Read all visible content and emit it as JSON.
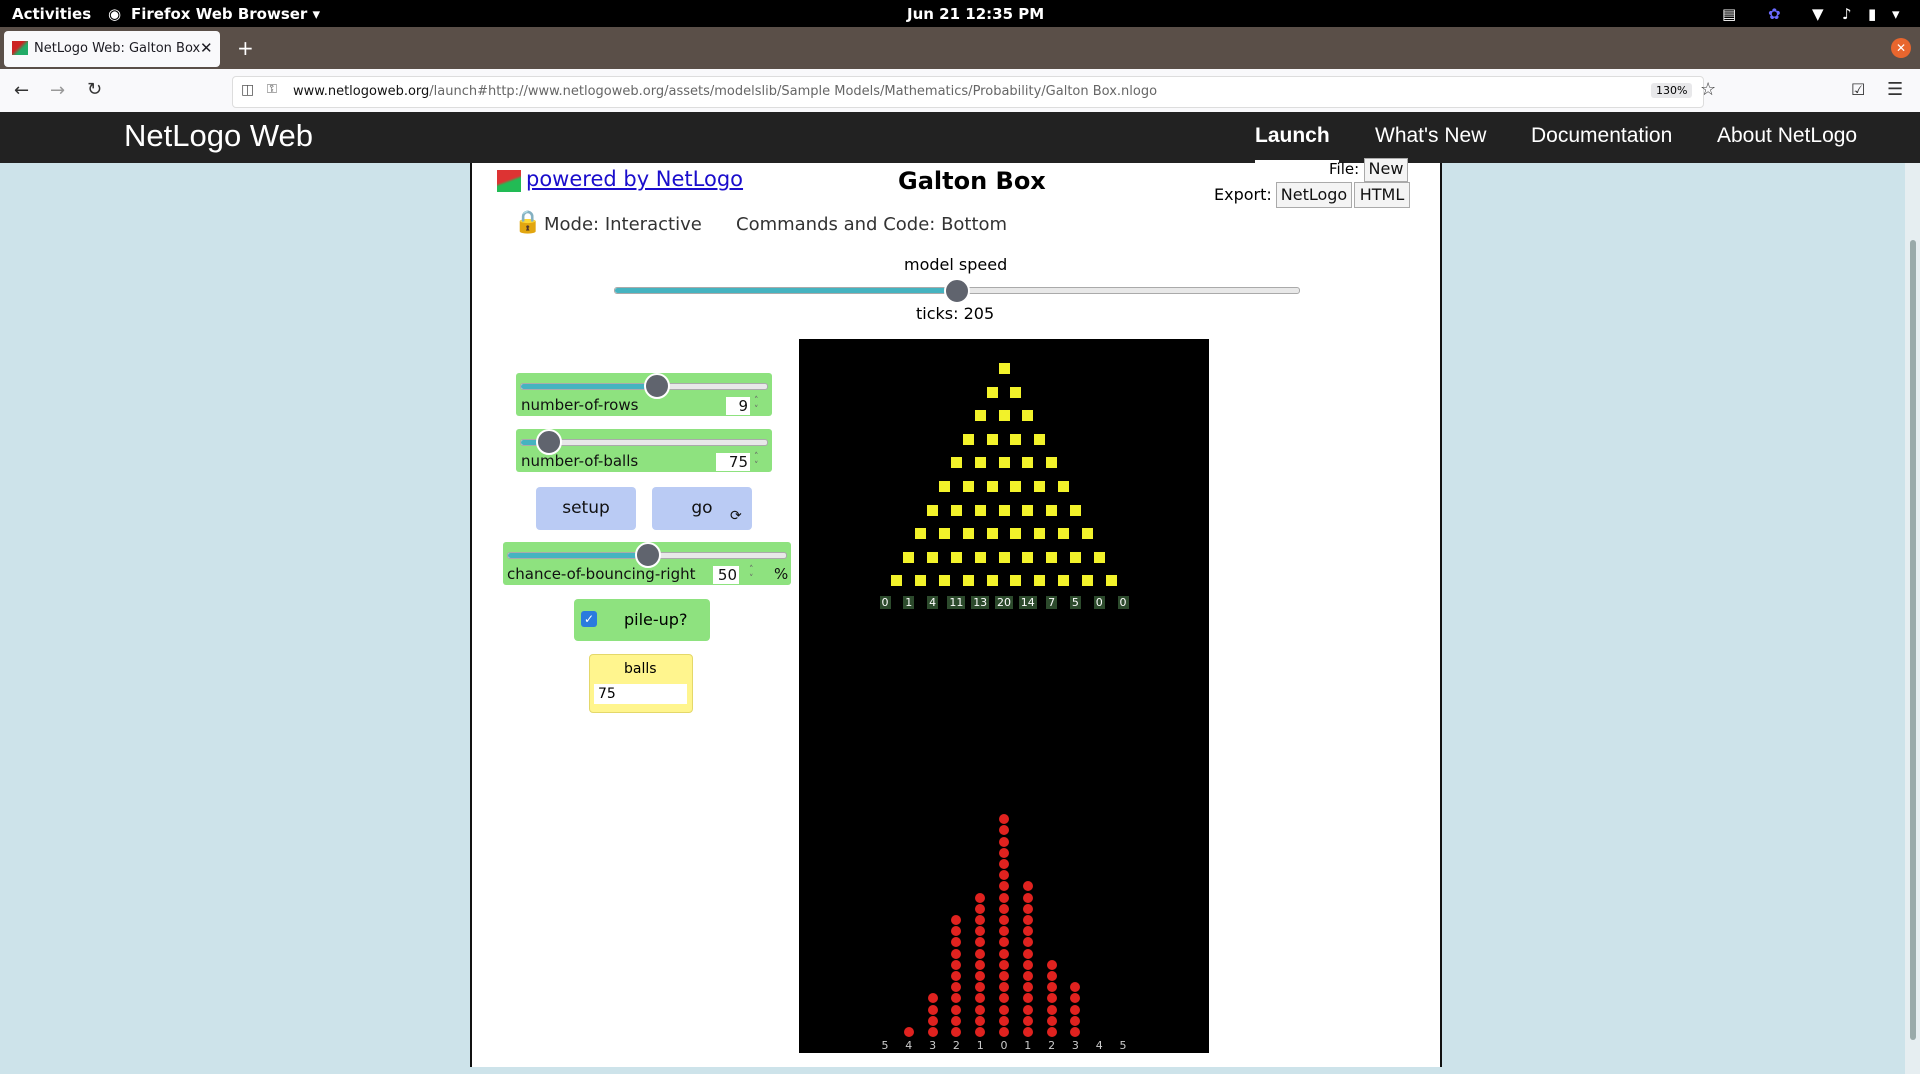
{
  "os": {
    "activities": "Activities",
    "app_menu": "Firefox Web Browser",
    "clock": "Jun 21  12:35 PM"
  },
  "browser": {
    "tab_title": "NetLogo Web: Galton Box",
    "url_domain": "www.netlogoweb.org",
    "url_rest": "/launch#http://www.netlogoweb.org/assets/modelslib/Sample Models/Mathematics/Probability/Galton Box.nlogo",
    "zoom": "130%"
  },
  "site": {
    "title": "NetLogo Web",
    "nav": [
      "Launch",
      "What's New",
      "Documentation",
      "About NetLogo"
    ]
  },
  "model": {
    "powered_by": "powered by NetLogo",
    "title": "Galton Box",
    "mode": "Mode: Interactive",
    "commands": "Commands and Code: Bottom",
    "file_label": "File:",
    "file_new": "New",
    "export_label": "Export:",
    "export_netlogo": "NetLogo",
    "export_html": "HTML",
    "speed_label": "model speed",
    "speed_value": 0.5,
    "ticks": "ticks: 205"
  },
  "widgets": {
    "rows": {
      "label": "number-of-rows",
      "value": "9",
      "fraction": 0.55
    },
    "balls_slider": {
      "label": "number-of-balls",
      "value": "75",
      "fraction": 0.1
    },
    "setup": "setup",
    "go": "go",
    "chance": {
      "label": "chance-of-bouncing-right",
      "value": "50",
      "unit": "%",
      "fraction": 0.5
    },
    "pileup": {
      "label": "pile-up?",
      "checked": true
    },
    "monitor": {
      "label": "balls",
      "value": "75"
    }
  },
  "world": {
    "bin_counts": [
      "0",
      "1",
      "4",
      "11",
      "13",
      "20",
      "14",
      "7",
      "5",
      "0",
      "0"
    ],
    "column_balls": [
      0,
      1,
      4,
      11,
      13,
      20,
      14,
      7,
      5,
      0,
      0
    ],
    "bin_labels": [
      "5",
      "4",
      "3",
      "2",
      "1",
      "0",
      "1",
      "2",
      "3",
      "4",
      "5"
    ],
    "peg_rows": 10,
    "colors": {
      "peg": "#f2f22a",
      "ball": "#e0221f",
      "background": "#000000"
    }
  }
}
